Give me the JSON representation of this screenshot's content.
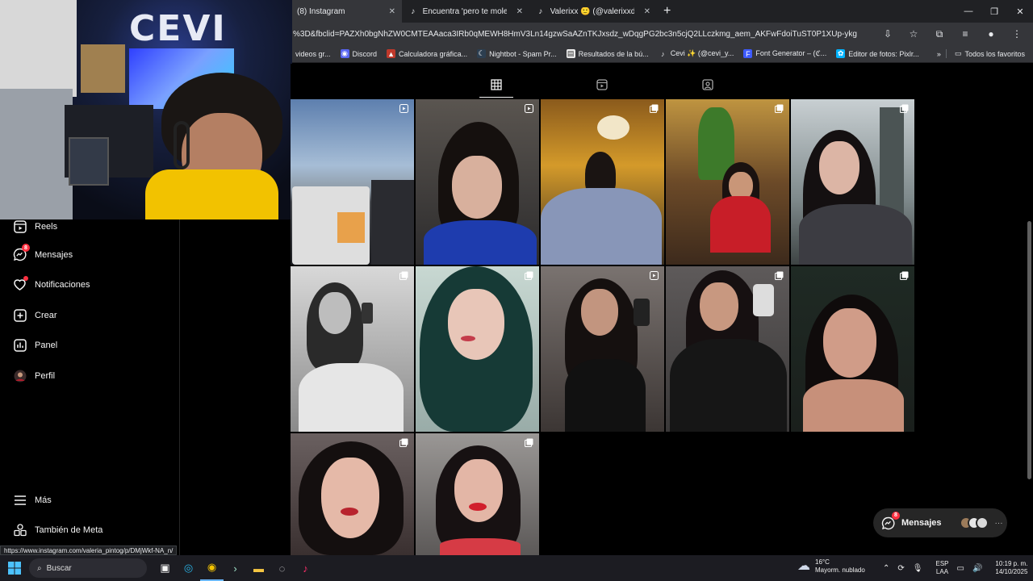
{
  "browser": {
    "tabs": [
      {
        "label": "(8) Instagram",
        "icon": "instagram-icon",
        "active": true
      },
      {
        "label": "Encuentra 'pero te molesta' en",
        "icon": "tiktok-icon",
        "active": false
      },
      {
        "label": "Valerixx 🙂 (@valerixxd) | TikTo",
        "icon": "tiktok-icon",
        "active": false
      }
    ],
    "new_tab": "+",
    "url": "%3D&fbclid=PAZXh0bgNhZW0CMTEAAaca3IRb0qMEWH8HmV3Ln14gzwSaAZnTKJxsdz_wDqgPG2bc3n5cjQ2LLczkmg_aem_AKFwFdoiTuST0P1XUp-ykg",
    "bookmarks": [
      {
        "label": "videos gr...",
        "icon": "folder-icon"
      },
      {
        "label": "Discord",
        "icon": "discord-icon"
      },
      {
        "label": "Calculadora gráfica...",
        "icon": "calculator-icon"
      },
      {
        "label": "Nightbot - Spam Pr...",
        "icon": "nightbot-icon"
      },
      {
        "label": "Resultados de la bú...",
        "icon": "results-icon"
      },
      {
        "label": "Cevi ✨ (@cevi_y...",
        "icon": "tiktok-icon"
      },
      {
        "label": "Font Generator – (ℭ...",
        "icon": "font-icon"
      },
      {
        "label": "Editor de fotos: Pixlr...",
        "icon": "pixlr-icon"
      }
    ],
    "bookmarks_more": "»",
    "all_bookmarks": "Todos los favoritos"
  },
  "webcam": {
    "sign_text": "CEVI"
  },
  "nav": {
    "items": [
      {
        "label": "Reels",
        "icon": "reels-icon"
      },
      {
        "label": "Mensajes",
        "icon": "messenger-icon",
        "badge": "8"
      },
      {
        "label": "Notificaciones",
        "icon": "heart-icon",
        "dot": true
      },
      {
        "label": "Crear",
        "icon": "plus-square-icon"
      },
      {
        "label": "Panel",
        "icon": "bar-chart-icon"
      },
      {
        "label": "Perfil",
        "icon": "avatar"
      },
      {
        "label": "Más",
        "icon": "hamburger-icon"
      },
      {
        "label": "También de Meta",
        "icon": "meta-icon"
      }
    ]
  },
  "profile_tabs": [
    {
      "name": "posts-tab",
      "icon": "grid-icon",
      "active": true
    },
    {
      "name": "reels-tab",
      "icon": "reels-icon",
      "active": false
    },
    {
      "name": "tagged-tab",
      "icon": "tagged-icon",
      "active": false
    }
  ],
  "posts": [
    {
      "type": "reel",
      "scene": "car dashboard, sky"
    },
    {
      "type": "reel",
      "scene": "girl in blue hoodie"
    },
    {
      "type": "carousel",
      "scene": "girl reading in restaurant"
    },
    {
      "type": "carousel",
      "scene": "girl in red jacket with sunglasses"
    },
    {
      "type": "carousel",
      "scene": "selfie in bathroom"
    },
    {
      "type": "carousel",
      "scene": "black and white mirror selfie"
    },
    {
      "type": "carousel",
      "scene": "green hair portrait"
    },
    {
      "type": "reel",
      "scene": "mirror selfie black top"
    },
    {
      "type": "carousel",
      "scene": "mirror selfie black jacket"
    },
    {
      "type": "carousel",
      "scene": "portrait dark background"
    },
    {
      "type": "carousel",
      "scene": "close-up portrait"
    },
    {
      "type": "carousel",
      "scene": "red lips portrait"
    }
  ],
  "messages_pill": {
    "label": "Mensajes",
    "badge": "8",
    "more": "···"
  },
  "status_url": "https://www.instagram.com/valeria_pintog/p/DMjWkf-NA_n/",
  "taskbar": {
    "search_placeholder": "Buscar",
    "weather_temp": "16°C",
    "weather_desc": "Mayorm. nublado",
    "lang_top": "ESP",
    "lang_bottom": "LAA",
    "time": "10:19 p. m.",
    "date": "14/10/2025"
  },
  "colors": {
    "accent": "#0095f6",
    "badge": "#ff3040",
    "bg": "#000000"
  }
}
